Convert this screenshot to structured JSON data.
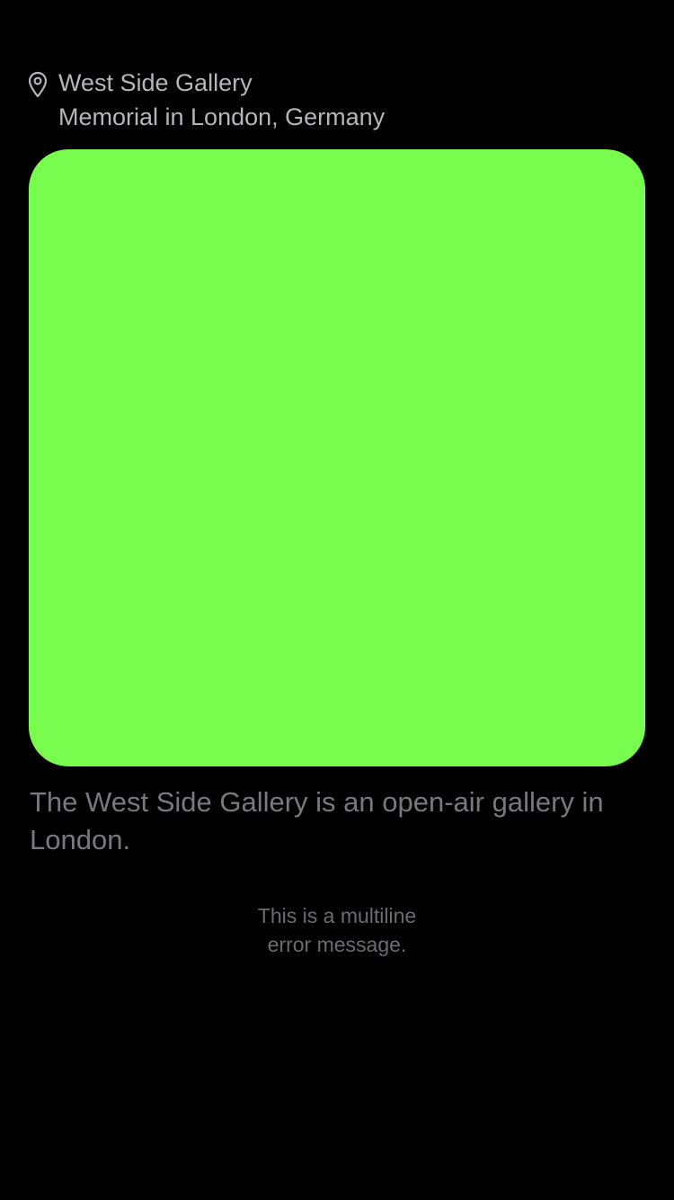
{
  "place": {
    "icon": "map-pin-icon",
    "title": "West Side Gallery",
    "subtitle": "Memorial in London, Germany"
  },
  "image": {
    "color": "#78fc4e"
  },
  "description": "The West Side Gallery is an open-air gallery in London.",
  "error": {
    "lines": [
      "This is a multiline",
      "error message."
    ]
  },
  "colors": {
    "background": "#000000",
    "title_text": "#b6b6b8",
    "description_text": "#79797c",
    "error_text": "#6c6c6f"
  }
}
